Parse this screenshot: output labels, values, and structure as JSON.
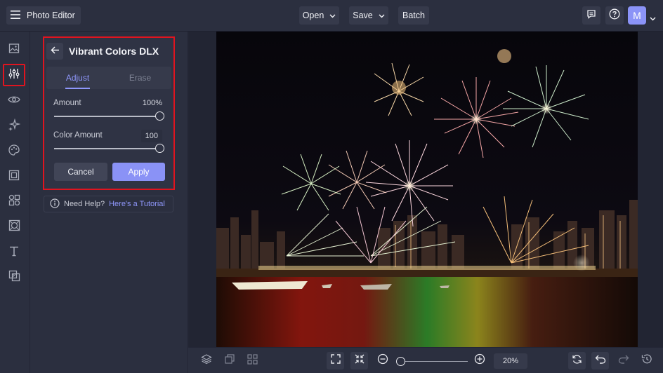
{
  "app": {
    "title": "Photo Editor"
  },
  "toolbar": {
    "open_label": "Open",
    "save_label": "Save",
    "batch_label": "Batch",
    "avatar_initial": "M"
  },
  "rail": {
    "items": [
      "image-icon",
      "adjust-sliders-icon",
      "eye-icon",
      "sparkle-icon",
      "palette-icon",
      "frame-icon",
      "shapes-icon",
      "texture-icon",
      "text-icon",
      "overlay-icon"
    ]
  },
  "panel": {
    "title": "Vibrant Colors DLX",
    "tabs": [
      "Adjust",
      "Erase"
    ],
    "active_tab": "Adjust",
    "amount_label": "Amount",
    "amount_value": "100%",
    "color_amount_label": "Color Amount",
    "color_amount_value": "100",
    "amount_level": 1.0,
    "color_amount_level": 1.0,
    "cancel_label": "Cancel",
    "apply_label": "Apply"
  },
  "help": {
    "text": "Need Help?",
    "link": "Here's a Tutorial"
  },
  "bottom": {
    "zoom": "20%"
  },
  "colors": {
    "accent": "#8a92f6",
    "highlight": "#e0141f",
    "background": "#2b2f3f"
  }
}
